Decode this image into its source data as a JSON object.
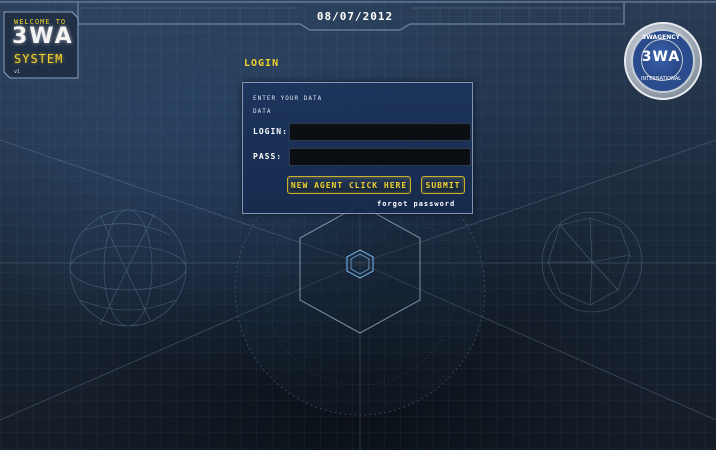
{
  "header": {
    "date": "08/07/2012"
  },
  "logo": {
    "welcome": "WELCOME TO",
    "name": "3WA",
    "system": "SYSTEM",
    "version": "v1"
  },
  "badge": {
    "top_text": "3WAGENCY",
    "logo_text": "3WA",
    "bottom_text": "INTERNATIONAL"
  },
  "login": {
    "title": "LOGIN",
    "intro_line1": "ENTER YOUR DATA",
    "intro_line2": "DATA",
    "login_label": "LOGIN:",
    "pass_label": "PASS:",
    "login_value": "",
    "pass_value": "",
    "new_agent_label": "NEW AGENT CLICK HERE",
    "submit_label": "SUBMIT",
    "forgot_label": "forgot password"
  },
  "colors": {
    "accent": "#f2d22a",
    "panel": "#1c345c",
    "background": "#1a2733"
  }
}
